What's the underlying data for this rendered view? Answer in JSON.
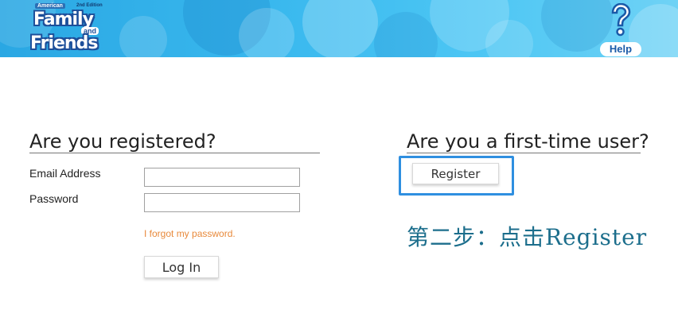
{
  "header": {
    "logo": {
      "badge_text": "American",
      "edition_text": "2nd Edition",
      "line1": "Family",
      "connector": "and",
      "line2": "Friends"
    },
    "help_label": "Help",
    "colors": {
      "banner": "#39b8ee",
      "logo_outline": "#1d4f9a",
      "help_text": "#1a5aa8"
    }
  },
  "login_section": {
    "title": "Are you registered?",
    "email_label": "Email Address",
    "email_value": "",
    "password_label": "Password",
    "password_value": "",
    "forgot_link": "I forgot my password.",
    "login_button": "Log In"
  },
  "register_section": {
    "title": "Are you a first-time user?",
    "register_button": "Register",
    "highlight_color": "#2f8fe0"
  },
  "annotation": {
    "text": "第二步：点击Register",
    "color": "#1c6e8c"
  }
}
